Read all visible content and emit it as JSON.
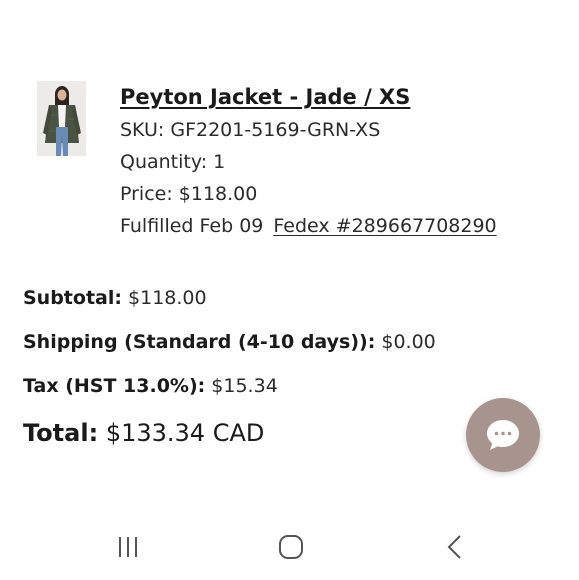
{
  "product": {
    "title": "Peyton Jacket - Jade / XS",
    "sku": "SKU: GF2201-5169-GRN-XS",
    "quantity": "Quantity: 1",
    "price": "Price: $118.00",
    "fulfilled": "Fulfilled Feb 09",
    "tracking": "Fedex #289667708290",
    "image_icon": "product-photo-icon"
  },
  "totals": {
    "subtotal_label": "Subtotal:",
    "subtotal_value": "$118.00",
    "shipping_label": "Shipping (Standard (4-10 days)):",
    "shipping_value": "$0.00",
    "tax_label": "Tax (HST 13.0%):",
    "tax_value": "$15.34",
    "total_label": "Total:",
    "total_value": "$133.34 CAD"
  },
  "chat": {
    "icon": "chat-bubble-icon",
    "color": "#a8948e"
  },
  "nav": {
    "recents_icon": "recents-icon",
    "home_icon": "home-icon",
    "back_icon": "back-icon"
  }
}
